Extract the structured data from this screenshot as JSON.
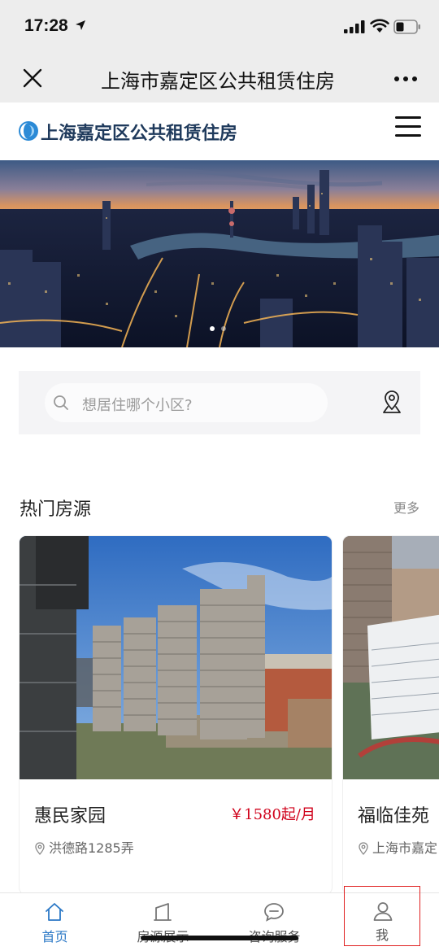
{
  "status_bar": {
    "time": "17:28"
  },
  "nav_bar": {
    "title": "上海市嘉定区公共租赁住房"
  },
  "site_header": {
    "title": "上海嘉定区公共租赁住房"
  },
  "search": {
    "placeholder": "想居住哪个小区?"
  },
  "hot_listings": {
    "title": "热门房源",
    "more_label": "更多",
    "items": [
      {
        "name": "惠民家园",
        "price": "￥1580起/月",
        "address": "洪德路1285弄"
      },
      {
        "name": "福临佳苑",
        "address": "上海市嘉定"
      }
    ]
  },
  "tabs": [
    {
      "label": "首页",
      "icon": "home-icon",
      "active": true
    },
    {
      "label": "房源展示",
      "icon": "building-icon",
      "active": false
    },
    {
      "label": "咨询服务",
      "icon": "chat-bubble-icon",
      "active": false
    },
    {
      "label": "我",
      "icon": "user-icon",
      "active": false
    }
  ],
  "colors": {
    "accent": "#2b78c6",
    "price": "#d0021b",
    "brand": "#1f3a5c"
  }
}
